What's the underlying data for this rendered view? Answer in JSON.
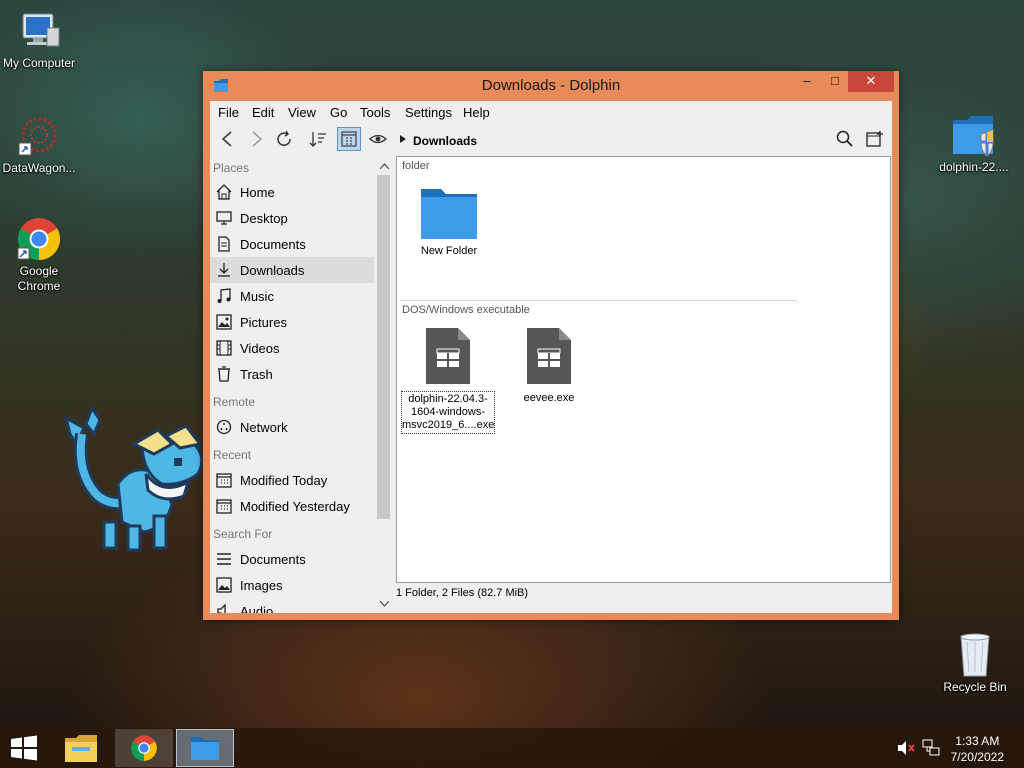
{
  "desktop": {
    "icons": {
      "my_computer": "My Computer",
      "datawagon": "DataWagon...",
      "chrome": "Google Chrome",
      "dolphin_installer": "dolphin-22....",
      "recycle_bin": "Recycle Bin"
    }
  },
  "window": {
    "title": "Downloads - Dolphin",
    "controls": {
      "minimize": "–",
      "maximize": "□",
      "close": "✕"
    },
    "menu": [
      "File",
      "Edit",
      "View",
      "Go",
      "Tools",
      "Settings",
      "Help"
    ],
    "breadcrumb": "Downloads",
    "places": {
      "sections": {
        "places": "Places",
        "remote": "Remote",
        "recent": "Recent",
        "search": "Search For"
      },
      "items": {
        "home": "Home",
        "desktop": "Desktop",
        "documents": "Documents",
        "downloads": "Downloads",
        "music": "Music",
        "pictures": "Pictures",
        "videos": "Videos",
        "trash": "Trash",
        "network": "Network",
        "modified_today": "Modified Today",
        "modified_yesterday": "Modified Yesterday",
        "search_documents": "Documents",
        "search_images": "Images",
        "search_audio": "Audio"
      },
      "selected": "Downloads"
    },
    "groups": {
      "folder": "folder",
      "executable": "DOS/Windows executable"
    },
    "files": {
      "new_folder": "New Folder",
      "dolphin_exe_line1": "dolphin-22.04.3-",
      "dolphin_exe_line2": "1604-windows-",
      "dolphin_exe_line3": "msvc2019_6....exe",
      "eevee_exe": "eevee.exe"
    },
    "status": "1 Folder, 2 Files (82.7 MiB)"
  },
  "taskbar": {
    "time": "1:33 AM",
    "date": "7/20/2022"
  },
  "colors": {
    "window_frame": "#e88a5a",
    "close_button": "#c7473a",
    "folder_blue": "#3d9be9",
    "selection": "#bcd6ee"
  }
}
